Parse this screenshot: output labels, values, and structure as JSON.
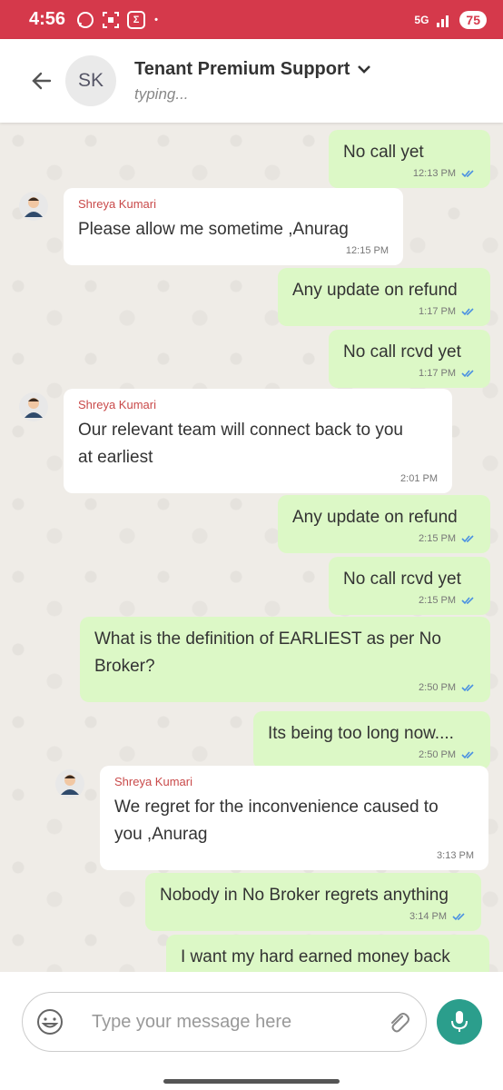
{
  "status_bar": {
    "time": "4:56",
    "network": "5G",
    "battery": "75",
    "accent_color": "#d5394b"
  },
  "header": {
    "avatar_initials": "SK",
    "title": "Tenant Premium Support",
    "subtitle": "typing..."
  },
  "messages": [
    {
      "direction": "out",
      "text": "No call yet",
      "time": "12:13 PM"
    },
    {
      "direction": "in",
      "sender": "Shreya Kumari",
      "text": "Please allow me sometime ,Anurag",
      "time": "12:15 PM"
    },
    {
      "direction": "out",
      "text": "Any update on refund",
      "time": "1:17 PM"
    },
    {
      "direction": "out",
      "text": "No call rcvd yet",
      "time": "1:17 PM"
    },
    {
      "direction": "in",
      "sender": "Shreya Kumari",
      "text": "Our relevant team will connect back to you at earliest",
      "time": "2:01 PM"
    },
    {
      "direction": "out",
      "text": "Any update on refund",
      "time": "2:15 PM"
    },
    {
      "direction": "out",
      "text": "No call rcvd yet",
      "time": "2:15 PM"
    },
    {
      "direction": "out",
      "text": "What is the definition of EARLIEST as per No Broker?",
      "time": "2:50 PM"
    },
    {
      "direction": "out",
      "text": "Its being too long now....",
      "time": "2:50 PM"
    },
    {
      "direction": "in",
      "sender": "Shreya Kumari",
      "text": "We regret for the inconvenience caused to you ,Anurag",
      "time": "3:13 PM"
    },
    {
      "direction": "out",
      "text": "Nobody in No Broker regrets anything",
      "time": "3:14 PM"
    },
    {
      "direction": "out",
      "text": "I want my hard earned money back",
      "time": ""
    }
  ],
  "composer": {
    "placeholder": "Type your message here"
  },
  "colors": {
    "outgoing_bubble": "#dcf8c6",
    "incoming_bubble": "#ffffff",
    "sender_name": "#c94a4a",
    "mic_button": "#2b9e8c",
    "read_ticks": "#4a90e2"
  }
}
